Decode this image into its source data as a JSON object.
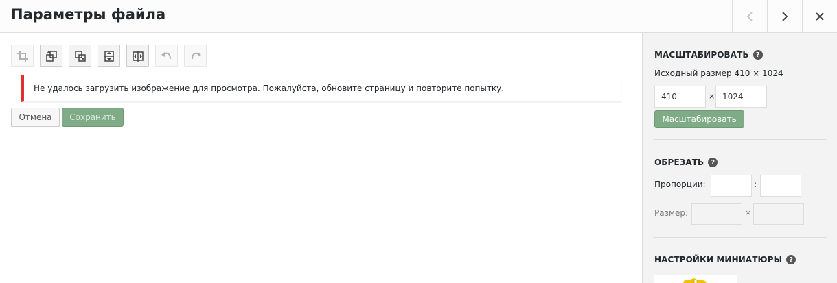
{
  "header": {
    "title": "Параметры файла",
    "prev_icon": "chevron-left-icon",
    "next_icon": "chevron-right-icon",
    "close_icon": "close-icon"
  },
  "toolbar": {
    "icons": [
      "crop-icon",
      "rotate-left-icon",
      "rotate-right-icon",
      "flip-vertical-icon",
      "flip-horizontal-icon",
      "undo-icon",
      "redo-icon"
    ]
  },
  "notice": {
    "text": "Не удалось загрузить изображение для просмотра. Пожалуйста, обновите страницу и повторите попытку."
  },
  "actions": {
    "cancel_label": "Отмена",
    "save_label": "Сохранить"
  },
  "scale": {
    "title": "МАСШТАБИРОВАТЬ",
    "original_size": "Исходный размер 410 × 1024",
    "width": "410",
    "height": "1024",
    "separator": "×",
    "button_label": "Масштабировать"
  },
  "crop": {
    "title": "ОБРЕЗАТЬ",
    "ratio_label": "Пропорции:",
    "ratio_separator": ":",
    "ratio_w": "",
    "ratio_h": "",
    "size_label": "Размер:",
    "size_separator": "×",
    "size_w": "",
    "size_h": ""
  },
  "thumbnail": {
    "title": "НАСТРОЙКИ МИНИАТЮРЫ"
  },
  "help_symbol": "?",
  "colors": {
    "accent_green": "#7fab86",
    "error_red": "#dc3232"
  }
}
